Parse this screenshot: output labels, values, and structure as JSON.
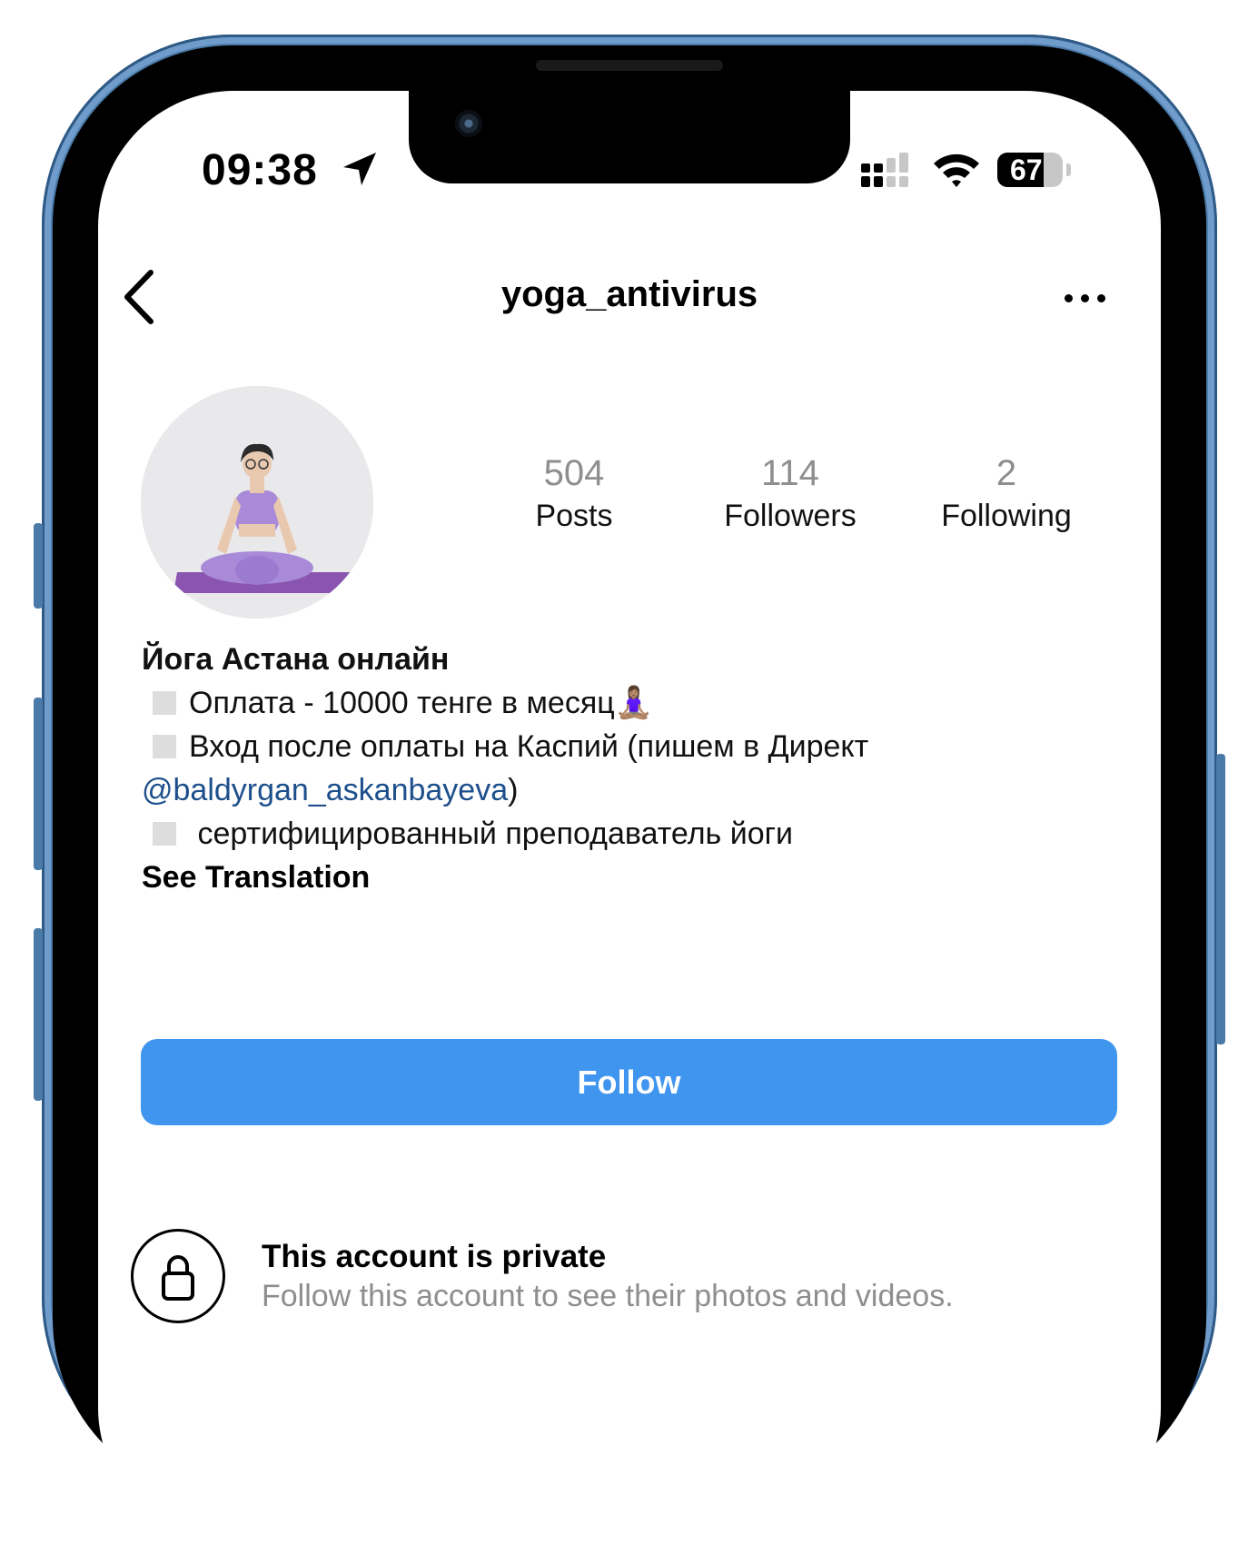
{
  "status_bar": {
    "time": "09:38",
    "battery": "67",
    "icons": [
      "location-arrow-icon",
      "cellular-signal-icon",
      "wifi-icon",
      "battery-icon"
    ]
  },
  "nav": {
    "username": "yoga_antivirus",
    "back_icon": "chevron-left-icon",
    "more_icon": "ellipsis-icon"
  },
  "profile": {
    "stats": [
      {
        "value": "504",
        "label": "Posts"
      },
      {
        "value": "114",
        "label": "Followers"
      },
      {
        "value": "2",
        "label": "Following"
      }
    ],
    "bio": {
      "name": "Йога Астана онлайн",
      "line1": "Оплата - 10000 тенге в месяц🧘🏽‍♀️",
      "line2": "Вход после оплаты на Каспий (пишем в Директ",
      "mention": "@baldyrgan_askanbayeva",
      "mention_close": ")",
      "line3": " сертифицированный преподаватель йоги",
      "see_translation": "See Translation"
    }
  },
  "actions": {
    "follow_label": "Follow",
    "follow_color": "#4096ef"
  },
  "private_notice": {
    "title": "This account is private",
    "subtitle": "Follow this account to see their photos and videos.",
    "icon": "lock-icon"
  },
  "colors": {
    "mention": "#1d4f8c",
    "secondary_text": "#8e8e8e"
  }
}
